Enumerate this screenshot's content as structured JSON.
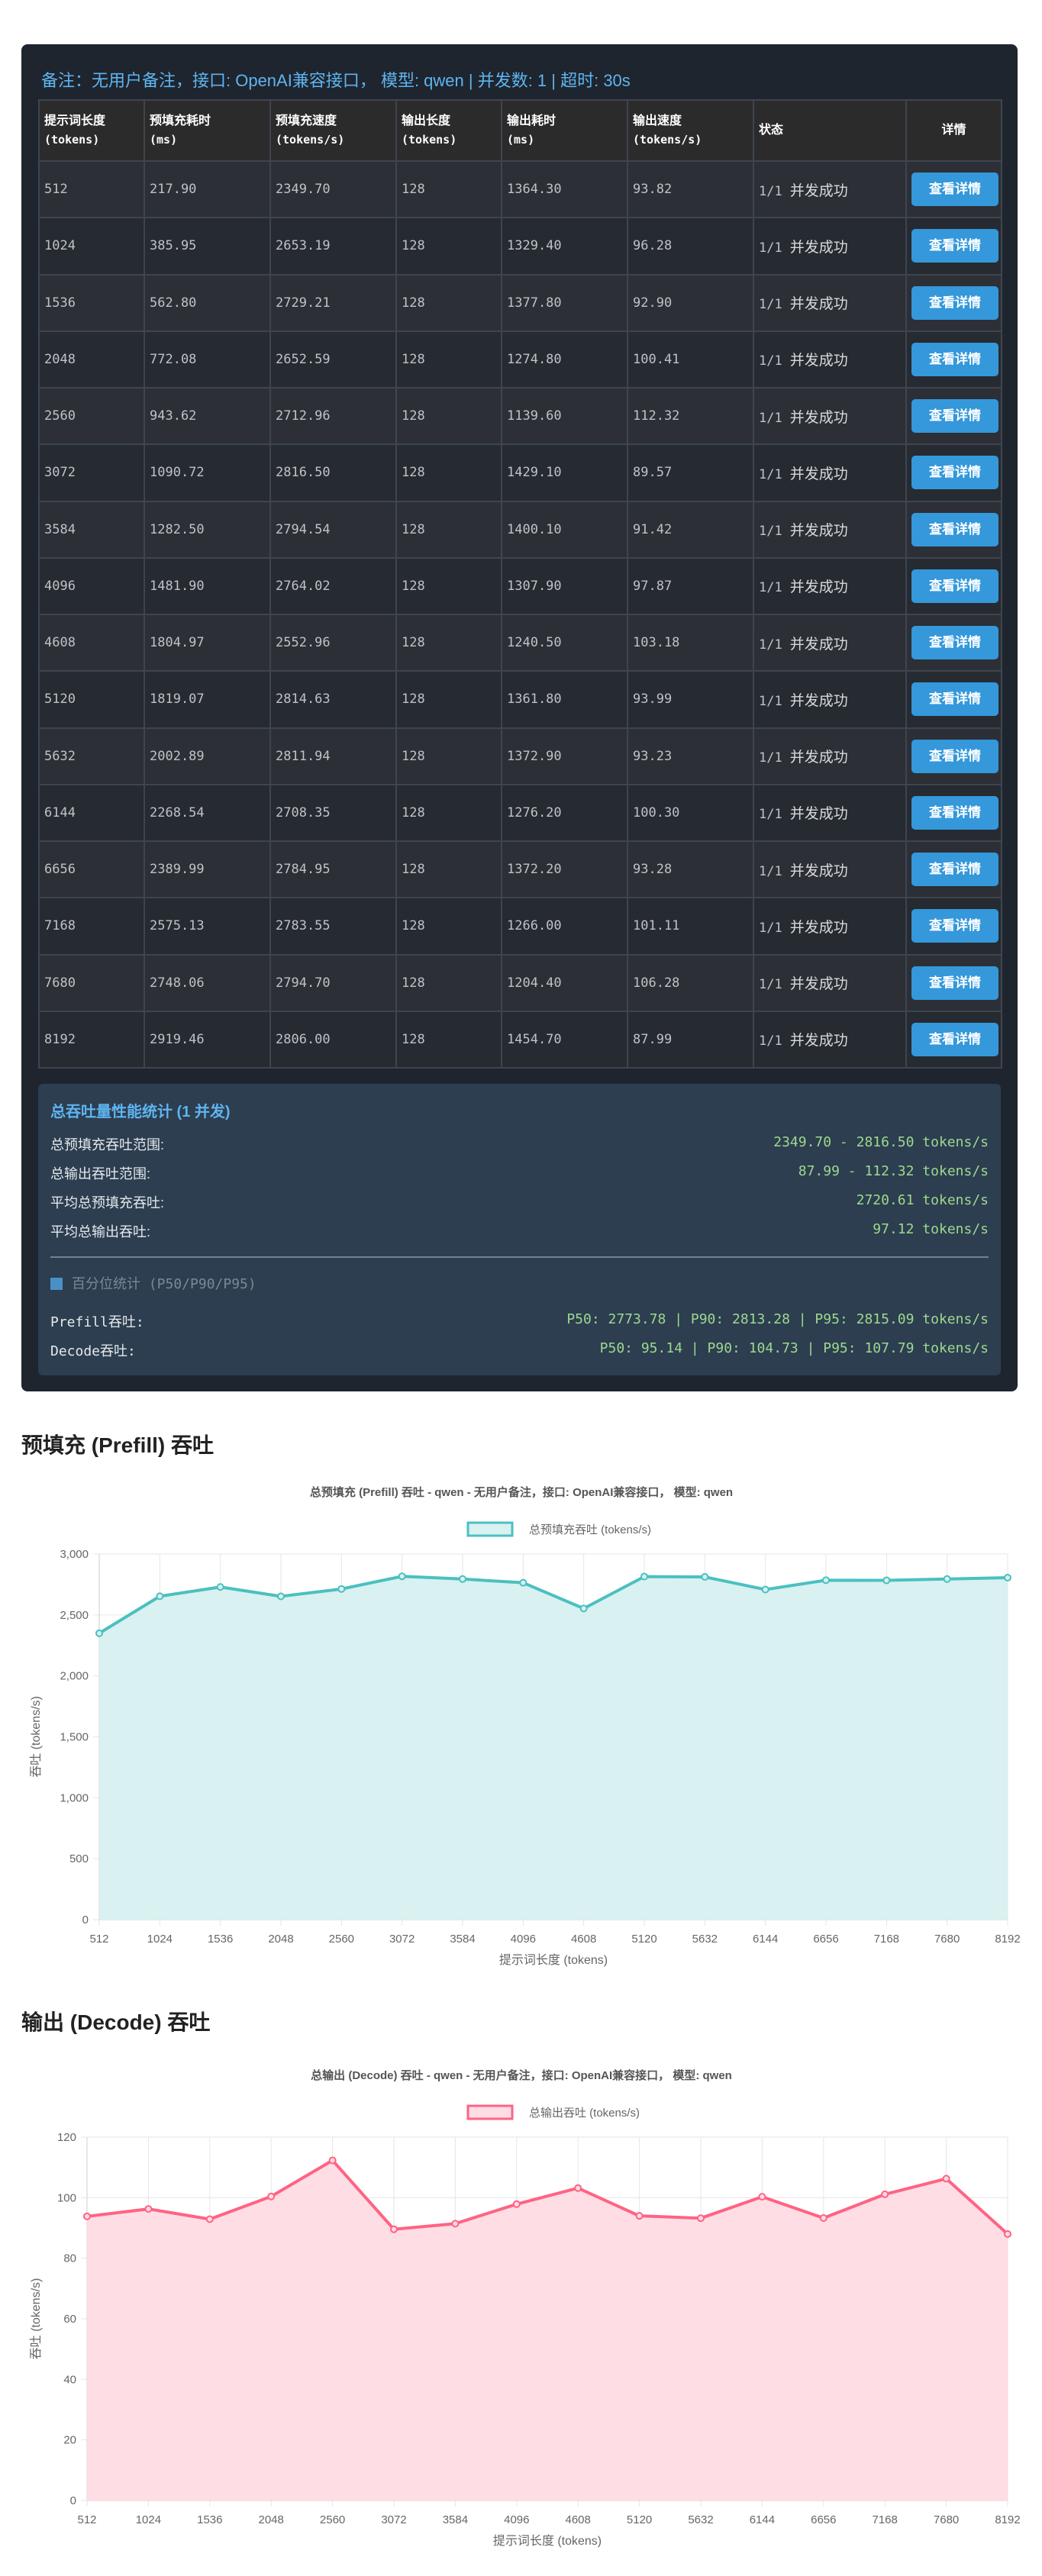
{
  "panel_title": "备注：无用户备注，接口: OpenAI兼容接口， 模型: qwen | 并发数: 1 | 超时: 30s",
  "table": {
    "headers": [
      {
        "l1": "提示词长度",
        "l2": "(tokens)"
      },
      {
        "l1": "预填充耗时",
        "l2": "(ms)"
      },
      {
        "l1": "预填充速度",
        "l2": "(tokens/s)"
      },
      {
        "l1": "输出长度",
        "l2": "(tokens)"
      },
      {
        "l1": "输出耗时",
        "l2": "(ms)"
      },
      {
        "l1": "输出速度",
        "l2": "(tokens/s)"
      },
      {
        "l1": "状态",
        "l2": ""
      },
      {
        "l1": "详情",
        "l2": ""
      }
    ],
    "button_label": "查看详情",
    "rows": [
      {
        "prompt": "512",
        "prefill_ms": "217.90",
        "prefill_speed": "2349.70",
        "out_len": "128",
        "out_ms": "1364.30",
        "out_speed": "93.82",
        "status_count": "1/1",
        "status_text": "并发成功"
      },
      {
        "prompt": "1024",
        "prefill_ms": "385.95",
        "prefill_speed": "2653.19",
        "out_len": "128",
        "out_ms": "1329.40",
        "out_speed": "96.28",
        "status_count": "1/1",
        "status_text": "并发成功"
      },
      {
        "prompt": "1536",
        "prefill_ms": "562.80",
        "prefill_speed": "2729.21",
        "out_len": "128",
        "out_ms": "1377.80",
        "out_speed": "92.90",
        "status_count": "1/1",
        "status_text": "并发成功"
      },
      {
        "prompt": "2048",
        "prefill_ms": "772.08",
        "prefill_speed": "2652.59",
        "out_len": "128",
        "out_ms": "1274.80",
        "out_speed": "100.41",
        "status_count": "1/1",
        "status_text": "并发成功"
      },
      {
        "prompt": "2560",
        "prefill_ms": "943.62",
        "prefill_speed": "2712.96",
        "out_len": "128",
        "out_ms": "1139.60",
        "out_speed": "112.32",
        "status_count": "1/1",
        "status_text": "并发成功"
      },
      {
        "prompt": "3072",
        "prefill_ms": "1090.72",
        "prefill_speed": "2816.50",
        "out_len": "128",
        "out_ms": "1429.10",
        "out_speed": "89.57",
        "status_count": "1/1",
        "status_text": "并发成功"
      },
      {
        "prompt": "3584",
        "prefill_ms": "1282.50",
        "prefill_speed": "2794.54",
        "out_len": "128",
        "out_ms": "1400.10",
        "out_speed": "91.42",
        "status_count": "1/1",
        "status_text": "并发成功"
      },
      {
        "prompt": "4096",
        "prefill_ms": "1481.90",
        "prefill_speed": "2764.02",
        "out_len": "128",
        "out_ms": "1307.90",
        "out_speed": "97.87",
        "status_count": "1/1",
        "status_text": "并发成功"
      },
      {
        "prompt": "4608",
        "prefill_ms": "1804.97",
        "prefill_speed": "2552.96",
        "out_len": "128",
        "out_ms": "1240.50",
        "out_speed": "103.18",
        "status_count": "1/1",
        "status_text": "并发成功"
      },
      {
        "prompt": "5120",
        "prefill_ms": "1819.07",
        "prefill_speed": "2814.63",
        "out_len": "128",
        "out_ms": "1361.80",
        "out_speed": "93.99",
        "status_count": "1/1",
        "status_text": "并发成功"
      },
      {
        "prompt": "5632",
        "prefill_ms": "2002.89",
        "prefill_speed": "2811.94",
        "out_len": "128",
        "out_ms": "1372.90",
        "out_speed": "93.23",
        "status_count": "1/1",
        "status_text": "并发成功"
      },
      {
        "prompt": "6144",
        "prefill_ms": "2268.54",
        "prefill_speed": "2708.35",
        "out_len": "128",
        "out_ms": "1276.20",
        "out_speed": "100.30",
        "status_count": "1/1",
        "status_text": "并发成功"
      },
      {
        "prompt": "6656",
        "prefill_ms": "2389.99",
        "prefill_speed": "2784.95",
        "out_len": "128",
        "out_ms": "1372.20",
        "out_speed": "93.28",
        "status_count": "1/1",
        "status_text": "并发成功"
      },
      {
        "prompt": "7168",
        "prefill_ms": "2575.13",
        "prefill_speed": "2783.55",
        "out_len": "128",
        "out_ms": "1266.00",
        "out_speed": "101.11",
        "status_count": "1/1",
        "status_text": "并发成功"
      },
      {
        "prompt": "7680",
        "prefill_ms": "2748.06",
        "prefill_speed": "2794.70",
        "out_len": "128",
        "out_ms": "1204.40",
        "out_speed": "106.28",
        "status_count": "1/1",
        "status_text": "并发成功"
      },
      {
        "prompt": "8192",
        "prefill_ms": "2919.46",
        "prefill_speed": "2806.00",
        "out_len": "128",
        "out_ms": "1454.70",
        "out_speed": "87.99",
        "status_count": "1/1",
        "status_text": "并发成功"
      }
    ]
  },
  "stats": {
    "title": "总吞吐量性能统计 (1 并发)",
    "prefill_range_label": "总预填充吞吐范围:",
    "prefill_range_value": "2349.70 - 2816.50 tokens/s",
    "decode_range_label": "总输出吞吐范围:",
    "decode_range_value": "87.99 - 112.32 tokens/s",
    "avg_prefill_label": "平均总预填充吞吐:",
    "avg_prefill_value": "2720.61 tokens/s",
    "avg_decode_label": "平均总输出吞吐:",
    "avg_decode_value": "97.12 tokens/s",
    "percentile_title": "百分位统计 (P50/P90/P95)",
    "prefill_pct_label": "Prefill吞吐:",
    "prefill_pct_value": "P50: 2773.78 | P90: 2813.28 | P95: 2815.09 tokens/s",
    "decode_pct_label": "Decode吞吐:",
    "decode_pct_value": "P50: 95.14 | P90: 104.73 | P95: 107.79 tokens/s"
  },
  "prefill_section_title": "预填充 (Prefill) 吞吐",
  "decode_section_title": "输出 (Decode) 吞吐",
  "chart_data": [
    {
      "type": "area",
      "title": "总预填充 (Prefill) 吞吐 - qwen - 无用户备注，接口: OpenAI兼容接口， 模型: qwen",
      "xlabel": "提示词长度 (tokens)",
      "ylabel": "吞吐 (tokens/s)",
      "ylim": [
        0,
        3000
      ],
      "yticks": [
        "0",
        "500",
        "1,000",
        "1,500",
        "2,000",
        "2,500",
        "3,000"
      ],
      "ytick_values": [
        0,
        500,
        1000,
        1500,
        2000,
        2500,
        3000
      ],
      "categories": [
        "512",
        "1024",
        "1536",
        "2048",
        "2560",
        "3072",
        "3584",
        "4096",
        "4608",
        "5120",
        "5632",
        "6144",
        "6656",
        "7168",
        "7680",
        "8192"
      ],
      "series": [
        {
          "name": "总预填充吞吐 (tokens/s)",
          "values": [
            2349.7,
            2653.19,
            2729.21,
            2652.59,
            2712.96,
            2816.5,
            2794.54,
            2764.02,
            2552.96,
            2814.63,
            2811.94,
            2708.35,
            2784.95,
            2783.55,
            2794.7,
            2806.0
          ]
        }
      ],
      "line_color": "#4bc0c0",
      "fill_color": "#d9f1f1",
      "legend": "top-center",
      "grid": true
    },
    {
      "type": "area",
      "title": "总输出 (Decode) 吞吐 - qwen - 无用户备注，接口: OpenAI兼容接口， 模型: qwen",
      "xlabel": "提示词长度 (tokens)",
      "ylabel": "吞吐 (tokens/s)",
      "ylim": [
        0,
        120
      ],
      "yticks": [
        "0",
        "20",
        "40",
        "60",
        "80",
        "100",
        "120"
      ],
      "ytick_values": [
        0,
        20,
        40,
        60,
        80,
        100,
        120
      ],
      "categories": [
        "512",
        "1024",
        "1536",
        "2048",
        "2560",
        "3072",
        "3584",
        "4096",
        "4608",
        "5120",
        "5632",
        "6144",
        "6656",
        "7168",
        "7680",
        "8192"
      ],
      "series": [
        {
          "name": "总输出吞吐 (tokens/s)",
          "values": [
            93.82,
            96.28,
            92.9,
            100.41,
            112.32,
            89.57,
            91.42,
            97.87,
            103.18,
            93.99,
            93.23,
            100.3,
            93.28,
            101.11,
            106.28,
            87.99
          ]
        }
      ],
      "line_color": "#ff6384",
      "fill_color": "#ffdde4",
      "legend": "top-center",
      "grid": true
    }
  ]
}
